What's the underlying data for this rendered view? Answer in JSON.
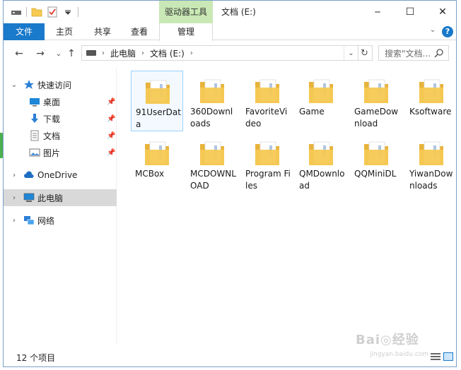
{
  "window": {
    "title": "文档 (E:)",
    "tool_tab": "驱动器工具",
    "controls": {
      "minimize": "─",
      "maximize": "☐",
      "close": "✕"
    }
  },
  "ribbon": {
    "file": "文件",
    "home": "主页",
    "share": "共享",
    "view": "查看",
    "manage": "管理",
    "help": "?"
  },
  "address": {
    "crumbs": [
      "此电脑",
      "文档 (E:)"
    ],
    "search_placeholder": "搜索\"文档..."
  },
  "sidebar": {
    "quick_access": "快速访问",
    "quick_items": [
      {
        "label": "桌面",
        "icon": "desktop-icon"
      },
      {
        "label": "下载",
        "icon": "download-icon"
      },
      {
        "label": "文档",
        "icon": "document-icon"
      },
      {
        "label": "图片",
        "icon": "picture-icon"
      }
    ],
    "onedrive": "OneDrive",
    "this_pc": "此电脑",
    "network": "网络"
  },
  "folders": [
    {
      "name": "91UserData",
      "selected": true
    },
    {
      "name": "360Downloads"
    },
    {
      "name": "FavoriteVideo"
    },
    {
      "name": "Game"
    },
    {
      "name": "GameDownload"
    },
    {
      "name": "Ksoftware"
    },
    {
      "name": "MCBox"
    },
    {
      "name": "MCDOWNLOAD"
    },
    {
      "name": "Program Files"
    },
    {
      "name": "QMDownload"
    },
    {
      "name": "QQMiniDL"
    },
    {
      "name": "YiwanDownloads"
    }
  ],
  "status": {
    "count": "12 个项目"
  },
  "watermark": {
    "main": "Bai◎经验",
    "sub": "jingyan.baidu.com"
  },
  "colors": {
    "accent": "#1979ca",
    "tool_tab": "#c9e8b5",
    "folder": "#f5c954",
    "selected_nav": "#d9d9d9"
  }
}
